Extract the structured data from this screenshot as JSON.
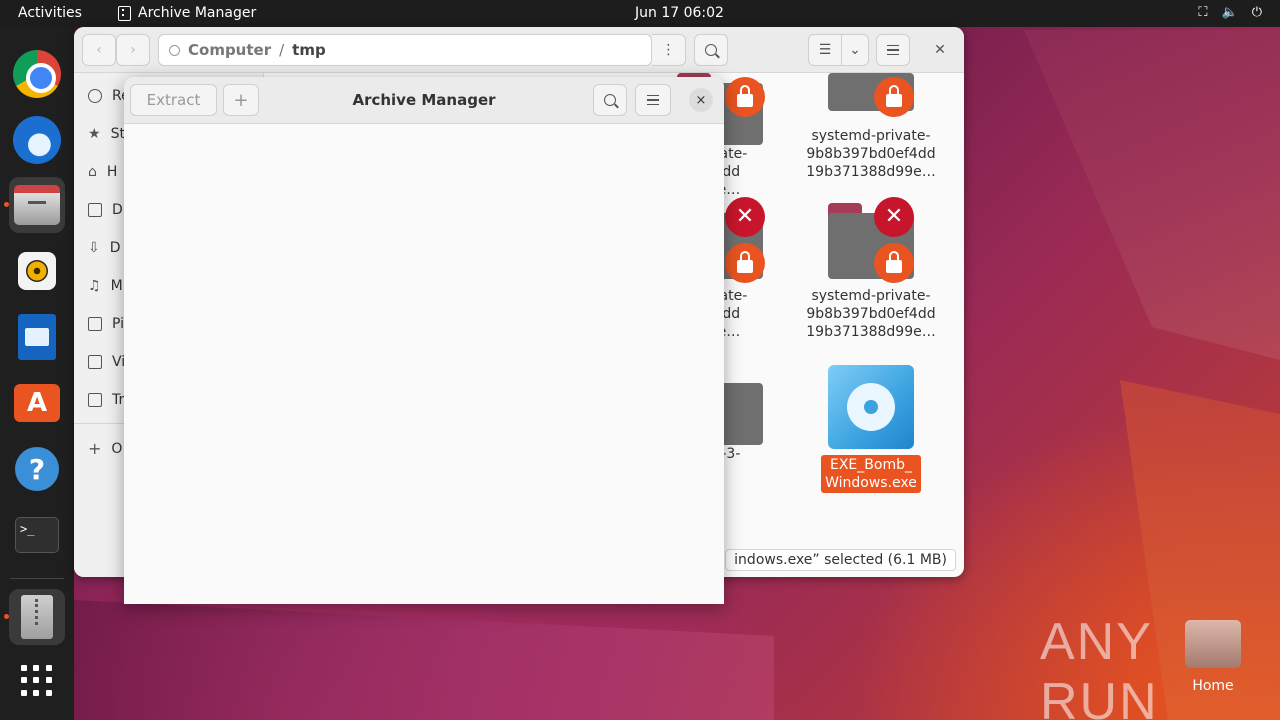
{
  "topbar": {
    "activities": "Activities",
    "app_name": "Archive Manager",
    "clock": "Jun 17  06:02"
  },
  "dock": {
    "items": [
      "chrome-icon",
      "thunderbird-icon",
      "files-icon",
      "rhythmbox-icon",
      "libreoffice-writer-icon",
      "app-center-icon",
      "help-icon",
      "terminal-icon",
      "archive-manager-icon",
      "show-apps-icon"
    ],
    "terminal_text": ">_"
  },
  "files": {
    "path_root": "Computer",
    "path_sep": "/",
    "path_current": "tmp",
    "sidebar": [
      "Re",
      "St",
      "H",
      "D",
      "D",
      "M",
      "Pi",
      "Vi",
      "Tr",
      "O"
    ],
    "items": [
      {
        "line1": "private-",
        "line2": "ef4dd",
        "line3": "99e…"
      },
      {
        "line1": "systemd-private-",
        "line2": "9b8b397bd0ef4dd",
        "line3": "19b371388d99e…"
      },
      {
        "line1": "private-",
        "line2": "ef4dd",
        "line3": "99e…"
      },
      {
        "line1": "systemd-private-",
        "line2": "9b8b397bd0ef4dd",
        "line3": "19b371388d99e…"
      },
      {
        "line1": "act-3-",
        "line2": "0"
      },
      {
        "line1": "EXE_Bomb_",
        "line2": "Windows.exe"
      }
    ],
    "status": "indows.exe” selected (6.1 MB)"
  },
  "archive": {
    "title": "Archive Manager",
    "extract_label": "Extract",
    "add_label": "+",
    "close_label": "×"
  },
  "desktop": {
    "watermark": "ANY RUN",
    "home_label": "Home"
  },
  "colors": {
    "accent": "#e95420",
    "topbar": "#1d1d1d",
    "dock": "#1f1f1f"
  }
}
